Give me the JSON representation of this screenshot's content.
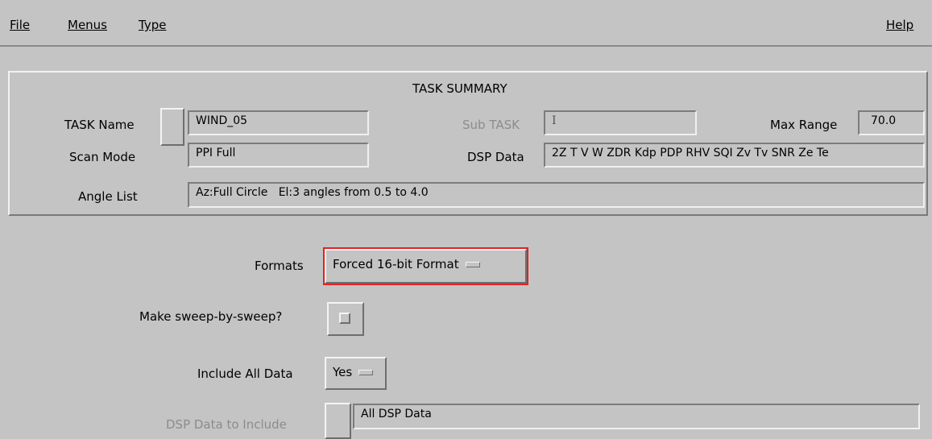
{
  "menubar": {
    "file": "File",
    "menus": "Menus",
    "type": "Type",
    "help": "Help"
  },
  "summary": {
    "title": "TASK SUMMARY",
    "task_name_label": "TASK Name",
    "task_name_value": "WIND_05",
    "sub_task_label": "Sub TASK",
    "sub_task_value": "",
    "max_range_label": "Max Range",
    "max_range_value": "70.0",
    "scan_mode_label": "Scan Mode",
    "scan_mode_value": "PPI Full",
    "dsp_data_label": "DSP Data",
    "dsp_data_value": "2Z T V W ZDR Kdp PDP RHV SQI Zv Tv SNR Ze Te",
    "angle_list_label": "Angle List",
    "angle_list_value": "Az:Full Circle   El:3 angles from 0.5 to 4.0"
  },
  "form": {
    "formats_label": "Formats",
    "formats_value": "Forced 16-bit Format",
    "sweep_label": "Make sweep-by-sweep?",
    "include_all_label": "Include All Data",
    "include_all_value": "Yes",
    "dsp_include_label": "DSP Data to Include",
    "dsp_include_value": "All DSP Data"
  }
}
